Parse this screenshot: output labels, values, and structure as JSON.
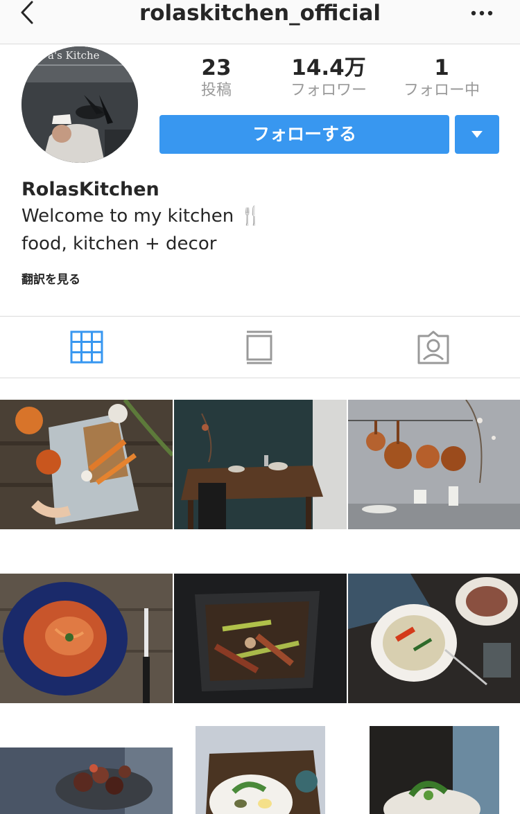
{
  "header": {
    "username": "rolaskitchen_official",
    "back_icon": "chevron-left-icon",
    "more_icon": "more-horizontal-icon"
  },
  "profile": {
    "avatar_text": "a's Kitche",
    "stats": [
      {
        "value": "23",
        "label": "投稿"
      },
      {
        "value": "14.4万",
        "label": "フォロワー"
      },
      {
        "value": "1",
        "label": "フォロー中"
      }
    ],
    "follow_label": "フォローする",
    "accent_color": "#3897f0"
  },
  "bio": {
    "name": "RolasKitchen",
    "line1": "Welcome to my kitchen 🍴",
    "line2": "food, kitchen + decor",
    "translate": "翻訳を見る"
  },
  "tabs": [
    {
      "icon": "grid-icon",
      "active": true
    },
    {
      "icon": "feed-icon",
      "active": false
    },
    {
      "icon": "tagged-icon",
      "active": false
    }
  ],
  "posts": [
    "post-vegetables-board",
    "post-dining-table",
    "post-copper-pans",
    "post-pasta-plate",
    "post-roast-pan",
    "post-soup-bowl",
    "post-figs-plate",
    "post-tray-salad",
    "post-herb-dish"
  ]
}
